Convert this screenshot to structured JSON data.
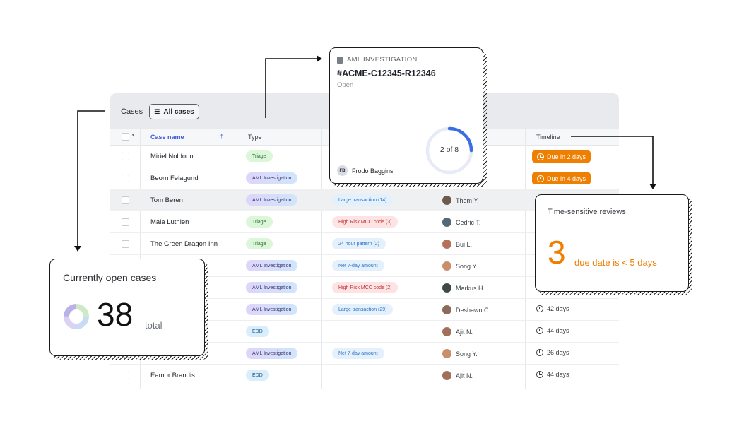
{
  "table": {
    "header_label": "Cases",
    "filter_button": "All cases",
    "columns": [
      "Case name",
      "Type",
      "Timeline"
    ],
    "rows": [
      {
        "name": "Miriel Noldorin",
        "type": "Triage",
        "flag": "",
        "assignee": "",
        "timeline": "Due in 2 days"
      },
      {
        "name": "Beorn Felagund",
        "type": "AML Investigation",
        "flag": "",
        "assignee": "",
        "timeline": "Due in 4 days"
      },
      {
        "name": "Tom Beren",
        "type": "AML Investigation",
        "flag": "Large transaction (14)",
        "assignee": "Thom Y.",
        "timeline": ""
      },
      {
        "name": "Maia Luthien",
        "type": "Triage",
        "flag": "High Risk MCC code (3)",
        "assignee": "Cedric T.",
        "timeline": ""
      },
      {
        "name": "The Green Dragon Inn",
        "type": "Triage",
        "flag": "24 hour pattern (2)",
        "assignee": "Bui L.",
        "timeline": ""
      },
      {
        "name": "",
        "type": "AML Investigation",
        "flag": "Net 7-day amount",
        "assignee": "Song Y.",
        "timeline": ""
      },
      {
        "name": "",
        "type": "AML Investigation",
        "flag": "High Risk MCC code (2)",
        "assignee": "Markus H.",
        "timeline": ""
      },
      {
        "name": "",
        "type": "AML Investigation",
        "flag": "Large transaction (29)",
        "assignee": "Deshawn C.",
        "timeline": "42 days"
      },
      {
        "name": "",
        "type": "EDD",
        "flag": "",
        "assignee": "Ajit N.",
        "timeline": "44 days"
      },
      {
        "name": "",
        "type": "AML Investigation",
        "flag": "Net 7-day amount",
        "assignee": "Song Y.",
        "timeline": "26 days"
      },
      {
        "name": "Eamor Brandis",
        "type": "EDD",
        "flag": "",
        "assignee": "Ajit N.",
        "timeline": "44 days"
      }
    ]
  },
  "aml_card": {
    "heading": "AML INVESTIGATION",
    "case_id": "#ACME-C12345-R12346",
    "status": "Open",
    "progress_label": "2 of 8",
    "progress_fraction": 0.25,
    "owner_initials": "FB",
    "owner_name": "Frodo Baggins"
  },
  "open_cases_card": {
    "title": "Currently open cases",
    "count": "38",
    "unit": "total"
  },
  "time_card": {
    "title": "Time-sensitive reviews",
    "count": "3",
    "description": "due date is < 5 days"
  },
  "colors": {
    "accent_orange": "#ee7f00",
    "sort_blue": "#3b5bdb",
    "progress_blue": "#3b6ee0"
  }
}
